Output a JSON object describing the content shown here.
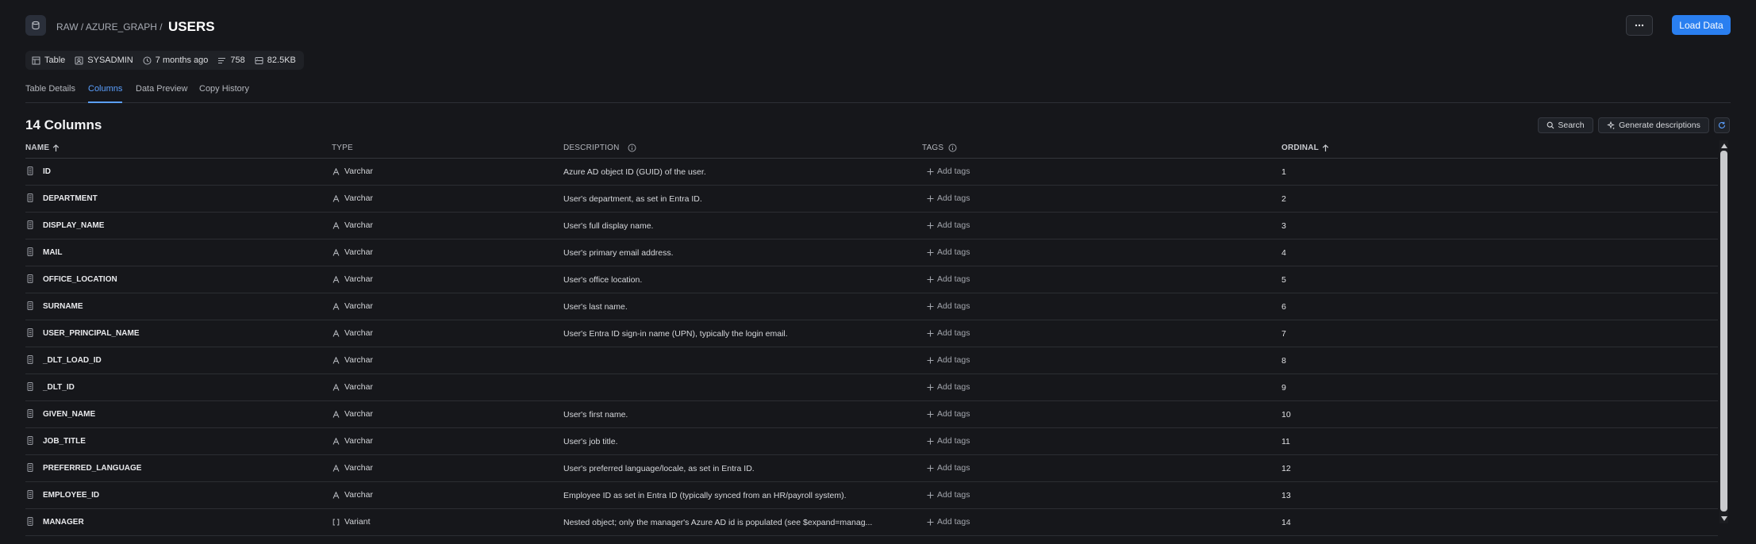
{
  "breadcrumb": {
    "parts": [
      "RAW",
      "AZURE_GRAPH"
    ],
    "separator": "/",
    "current": "USERS"
  },
  "actions": {
    "more_icon": "ellipsis-icon",
    "load_label": "Load Data"
  },
  "meta": {
    "type": "Table",
    "owner": "SYSADMIN",
    "modified": "7 months ago",
    "rows": "758",
    "size": "82.5KB"
  },
  "tabs": [
    "Table Details",
    "Columns",
    "Data Preview",
    "Copy History"
  ],
  "active_tab": "Columns",
  "columns_section": {
    "title": "14 Columns",
    "search_label": "Search",
    "generate_label": "Generate descriptions"
  },
  "table": {
    "headers": {
      "name": "NAME",
      "type": "TYPE",
      "description": "DESCRIPTION",
      "tags": "TAGS",
      "ordinal": "ORDINAL"
    },
    "add_tags_label": "Add tags",
    "rows": [
      {
        "name": "ID",
        "type": "Varchar",
        "type_icon": "text-type-icon",
        "description": "Azure AD object ID (GUID) of the user.",
        "ordinal": "1"
      },
      {
        "name": "DEPARTMENT",
        "type": "Varchar",
        "type_icon": "text-type-icon",
        "description": "User's department, as set in Entra ID.",
        "ordinal": "2"
      },
      {
        "name": "DISPLAY_NAME",
        "type": "Varchar",
        "type_icon": "text-type-icon",
        "description": "User's full display name.",
        "ordinal": "3"
      },
      {
        "name": "MAIL",
        "type": "Varchar",
        "type_icon": "text-type-icon",
        "description": "User's primary email address.",
        "ordinal": "4"
      },
      {
        "name": "OFFICE_LOCATION",
        "type": "Varchar",
        "type_icon": "text-type-icon",
        "description": "User's office location.",
        "ordinal": "5"
      },
      {
        "name": "SURNAME",
        "type": "Varchar",
        "type_icon": "text-type-icon",
        "description": "User's last name.",
        "ordinal": "6"
      },
      {
        "name": "USER_PRINCIPAL_NAME",
        "type": "Varchar",
        "type_icon": "text-type-icon",
        "description": "User's Entra ID sign-in name (UPN), typically the login email.",
        "ordinal": "7"
      },
      {
        "name": "_DLT_LOAD_ID",
        "type": "Varchar",
        "type_icon": "text-type-icon",
        "description": "",
        "ordinal": "8"
      },
      {
        "name": "_DLT_ID",
        "type": "Varchar",
        "type_icon": "text-type-icon",
        "description": "",
        "ordinal": "9"
      },
      {
        "name": "GIVEN_NAME",
        "type": "Varchar",
        "type_icon": "text-type-icon",
        "description": "User's first name.",
        "ordinal": "10"
      },
      {
        "name": "JOB_TITLE",
        "type": "Varchar",
        "type_icon": "text-type-icon",
        "description": "User's job title.",
        "ordinal": "11"
      },
      {
        "name": "PREFERRED_LANGUAGE",
        "type": "Varchar",
        "type_icon": "text-type-icon",
        "description": "User's preferred language/locale, as set in Entra ID.",
        "ordinal": "12"
      },
      {
        "name": "EMPLOYEE_ID",
        "type": "Varchar",
        "type_icon": "text-type-icon",
        "description": "Employee ID as set in Entra ID (typically synced from an HR/payroll system).",
        "ordinal": "13"
      },
      {
        "name": "MANAGER",
        "type": "Variant",
        "type_icon": "variant-type-icon",
        "description": "Nested object; only the manager's Azure AD id is populated (see $expand=manag...",
        "ordinal": "14"
      }
    ]
  },
  "colors": {
    "accent": "#2a7ff0",
    "background": "#16171b",
    "active_tab": "#5ba0ff"
  }
}
